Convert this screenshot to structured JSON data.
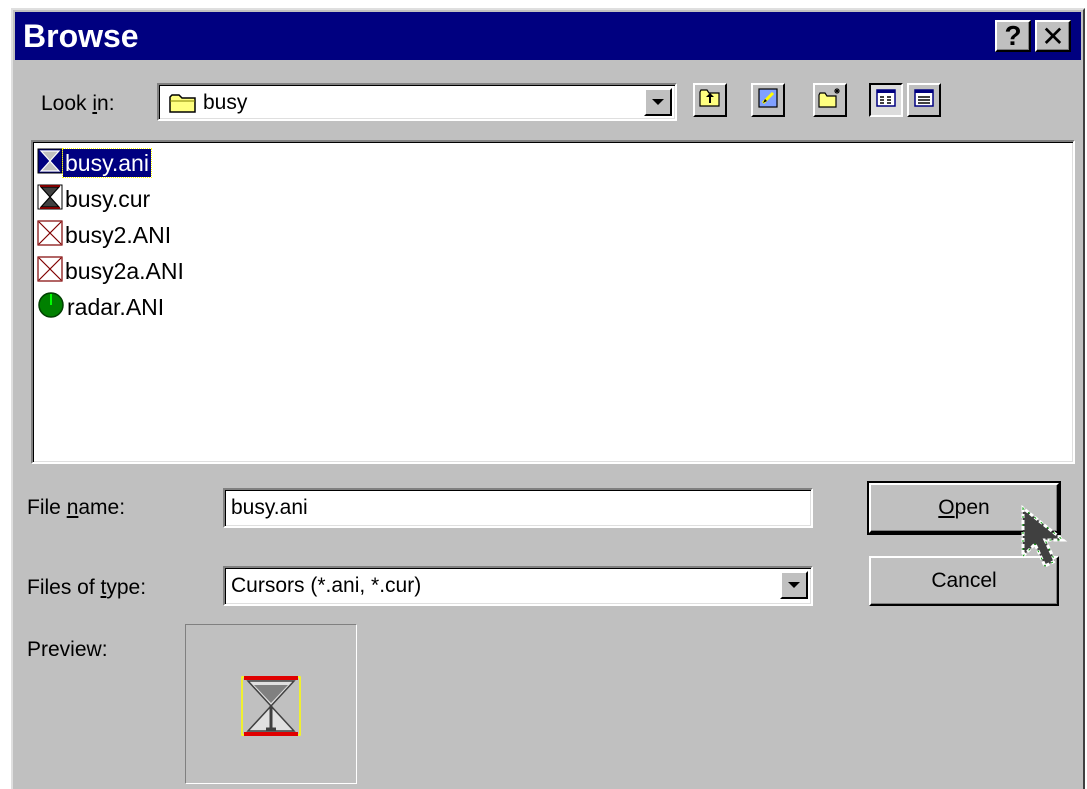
{
  "titlebar": {
    "title": "Browse",
    "help_label": "?",
    "close_label": "✕"
  },
  "look_in": {
    "label_pre": "Look ",
    "label_key": "i",
    "label_post": "n:",
    "value": "busy",
    "icon": "folder-icon"
  },
  "toolbar": {
    "icons": [
      "up-one-level-icon",
      "desktop-icon",
      "new-folder-icon",
      "list-view-icon",
      "details-view-icon"
    ]
  },
  "files": [
    {
      "name": "busy.ani",
      "icon": "hourglass-icon",
      "selected": true
    },
    {
      "name": "busy.cur",
      "icon": "hourglass-icon",
      "selected": false
    },
    {
      "name": "busy2.ANI",
      "icon": "hourglass-outline-icon",
      "selected": false
    },
    {
      "name": "busy2a.ANI",
      "icon": "hourglass-outline-icon",
      "selected": false
    },
    {
      "name": "radar.ANI",
      "icon": "radar-icon",
      "selected": false
    }
  ],
  "file_name": {
    "label_pre": "File ",
    "label_key": "n",
    "label_post": "ame:",
    "value": "busy.ani"
  },
  "files_of_type": {
    "label_pre": "Files of ",
    "label_key": "t",
    "label_post": "ype:",
    "value": "Cursors (*.ani, *.cur)"
  },
  "buttons": {
    "open_key": "O",
    "open_rest": "pen",
    "cancel": "Cancel"
  },
  "preview": {
    "label": "Preview:",
    "icon": "hourglass-preview-icon"
  },
  "colors": {
    "titlebar": "#000080",
    "face": "#c0c0c0",
    "selection": "#000080"
  }
}
